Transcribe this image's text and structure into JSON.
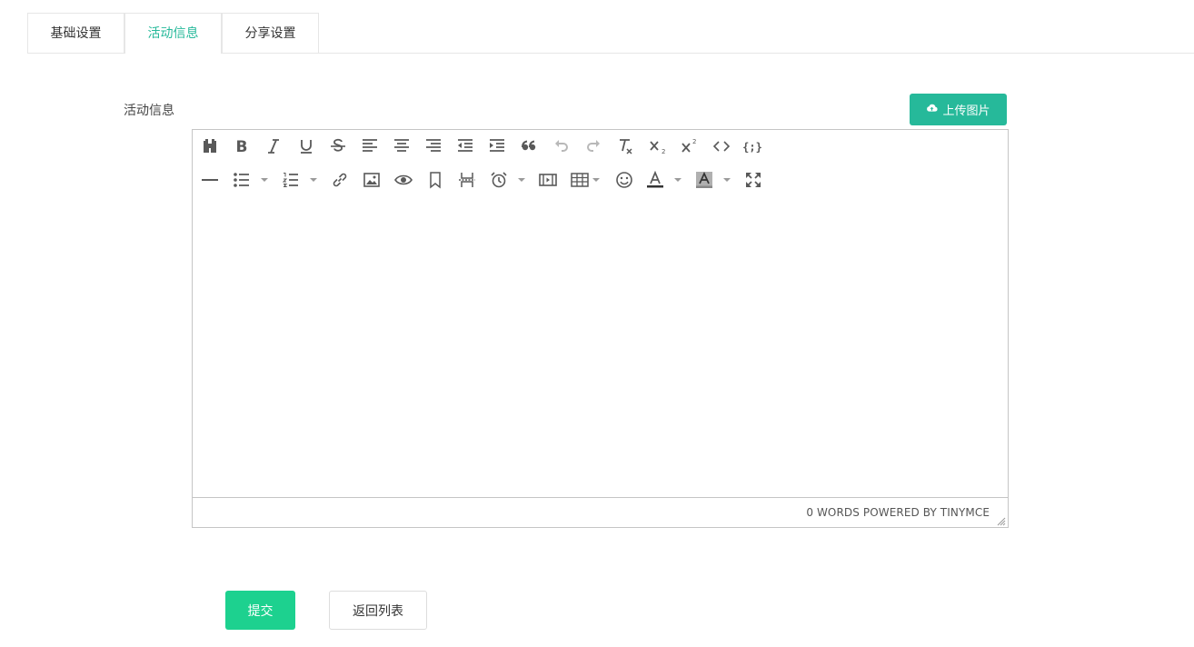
{
  "tabs": [
    {
      "label": "基础设置",
      "active": false
    },
    {
      "label": "活动信息",
      "active": true
    },
    {
      "label": "分享设置",
      "active": false
    }
  ],
  "form": {
    "field_label": "活动信息",
    "upload_button": "上传图片"
  },
  "editor": {
    "toolbar_row1": [
      "find-replace",
      "bold",
      "italic",
      "underline",
      "strikethrough",
      "align-left",
      "align-center",
      "align-right",
      "outdent",
      "indent",
      "blockquote",
      "undo",
      "redo",
      "remove-format",
      "subscript",
      "superscript",
      "source-code",
      "code-sample"
    ],
    "toolbar_row2": [
      "horizontal-rule",
      "bullet-list",
      "numbered-list",
      "link",
      "image",
      "preview",
      "anchor",
      "page-break",
      "insert-datetime",
      "media",
      "table",
      "emoticons",
      "text-color",
      "background-color",
      "fullscreen"
    ],
    "content": "",
    "status_text": "0 WORDS POWERED BY TINYMCE"
  },
  "actions": {
    "submit_label": "提交",
    "back_label": "返回列表"
  },
  "colors": {
    "accent": "#26b99a",
    "submit": "#1dd18f"
  }
}
